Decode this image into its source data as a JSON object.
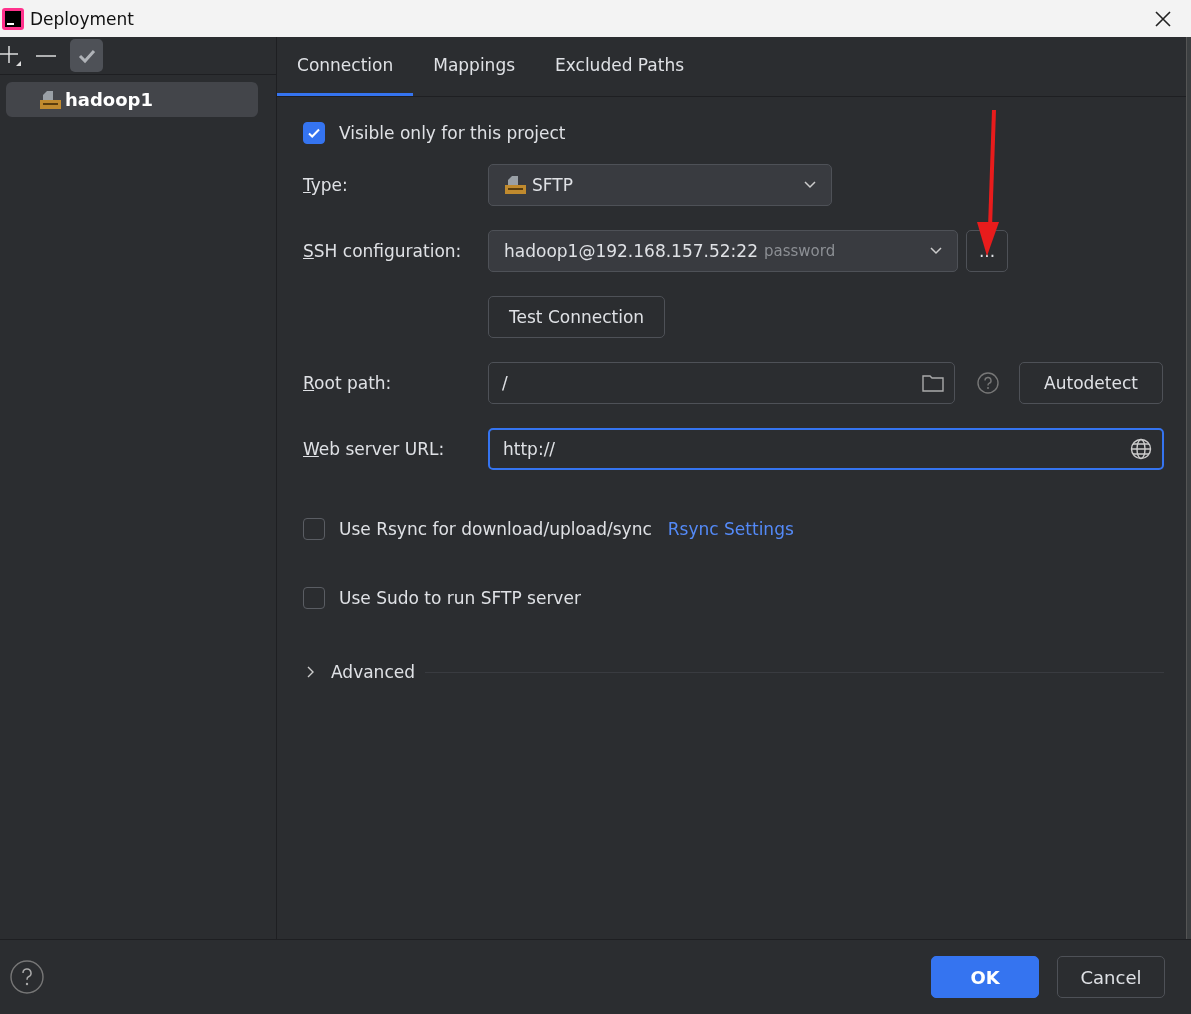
{
  "window": {
    "title": "Deployment"
  },
  "servers": [
    {
      "name": "hadoop1",
      "selected": true
    }
  ],
  "tabs": [
    {
      "label": "Connection",
      "selected": true
    },
    {
      "label": "Mappings",
      "selected": false
    },
    {
      "label": "Excluded Paths",
      "selected": false
    }
  ],
  "visible_only": {
    "label": "Visible only for this project",
    "checked": true
  },
  "type": {
    "label": "Type:",
    "value": "SFTP"
  },
  "ssh": {
    "label": "SSH configuration:",
    "value": "hadoop1@192.168.157.52:22",
    "hint": "password",
    "browse": "..."
  },
  "test_button": "Test Connection",
  "root_path": {
    "label": "Root path:",
    "value": "/",
    "autodetect": "Autodetect"
  },
  "web_url": {
    "label": "Web server URL:",
    "value": "http://",
    "focused": true
  },
  "rsync": {
    "label": "Use Rsync for download/upload/sync",
    "checked": false,
    "link": "Rsync Settings"
  },
  "sudo": {
    "label": "Use Sudo to run SFTP server",
    "checked": false
  },
  "advanced": {
    "label": "Advanced",
    "expanded": false
  },
  "buttons": [
    {
      "label": "OK",
      "kind": "primary"
    },
    {
      "label": "Cancel",
      "kind": "secondary"
    }
  ]
}
